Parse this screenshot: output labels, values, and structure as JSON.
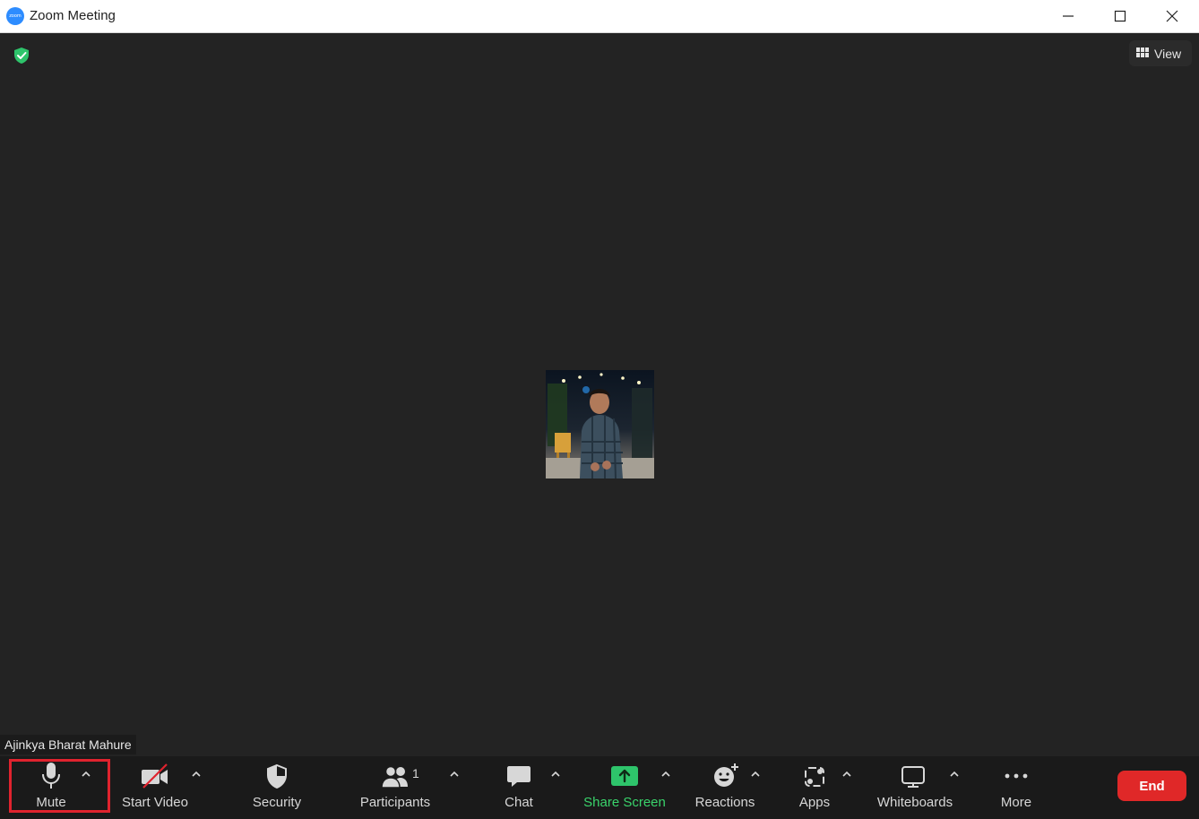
{
  "window": {
    "title": "Zoom Meeting",
    "logo_text": "zoom"
  },
  "meeting": {
    "view_label": "View",
    "participant_name": "Ajinkya Bharat Mahure"
  },
  "toolbar": {
    "mute_label": "Mute",
    "start_video_label": "Start Video",
    "security_label": "Security",
    "participants_label": "Participants",
    "participant_count": "1",
    "chat_label": "Chat",
    "share_screen_label": "Share Screen",
    "reactions_label": "Reactions",
    "apps_label": "Apps",
    "whiteboards_label": "Whiteboards",
    "more_label": "More",
    "end_label": "End"
  },
  "colors": {
    "accent_green": "#3ad36b",
    "end_red": "#e02828",
    "highlight_red": "#e0232e",
    "background": "#232323"
  }
}
